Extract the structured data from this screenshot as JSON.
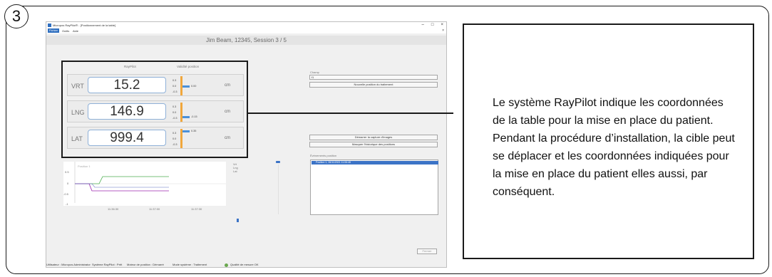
{
  "step": {
    "number": "3"
  },
  "app": {
    "title": "Micropos RayPilot® - [Positionnement de la table]",
    "window_buttons": [
      "–",
      "□",
      "×"
    ],
    "menu": [
      "Fichier",
      "Outils",
      "Aide"
    ],
    "patient_header": "Jim Beam, 12345, Session 3 / 5",
    "champ": {
      "label": "Champ",
      "value": "f1",
      "new_position_button": "Nouvelle position du traitement"
    },
    "capture_button": "Démarrer la capture d'images",
    "history_button": "Masquer l'historique des positions",
    "events": {
      "label": "Événements position",
      "rows": [
        "Position 1, 26/11/2021 11:06:48"
      ]
    },
    "graph": {
      "legend": [
        "Vrt",
        "Lng",
        "Lat"
      ],
      "x_ticks": [
        "11:36:30",
        "11:37:00",
        "11:37:30"
      ],
      "y_ticks": [
        "0.5",
        "0",
        "-0.5",
        "-1"
      ],
      "corner_label": "Position 1"
    },
    "bottom_button": "Fermer",
    "status": {
      "user": "Utilisateur : Micropos Administrator",
      "system": "Système RayPilot : Prêt",
      "motor": "Moteur de position : Démarré",
      "mode": "Mode système : Traitement",
      "quality": "Qualité de mesure OK"
    }
  },
  "zoom": {
    "headers": {
      "raypilot": "RayPilot",
      "validity": "Validité position"
    },
    "rows": [
      {
        "axis": "VRT",
        "value": "15.2",
        "unit": "cm",
        "ticks": [
          "0.3",
          "0.0",
          "-0.3"
        ],
        "tolerance_value": "0.00",
        "tolerance_level": 0.5
      },
      {
        "axis": "LNG",
        "value": "146.9",
        "unit": "cm",
        "ticks": [
          "0.3",
          "0.0",
          "-0.3"
        ],
        "tolerance_value": "-0.15",
        "tolerance_level": 0.75
      },
      {
        "axis": "LAT",
        "value": "999.4",
        "unit": "cm",
        "ticks": [
          "0.3",
          "0.0",
          "-0.3"
        ],
        "tolerance_value": "0.35",
        "tolerance_level": 0.1
      }
    ]
  },
  "info_text": "Le système RayPilot indique les coordonnées de la table pour la mise en place du patient. Pendant la procédure d’installation, la cible peut se déplacer et les coordonnées indiquées pour la mise en place du patient elles aussi, par conséquent.",
  "colors": {
    "accent": "#2f6fbf",
    "scale": "#f1a73c",
    "tolerance": "#4a90d9",
    "vrt_line": "#4caf50",
    "lng_line": "#9c27b0",
    "lat_line": "#5c6bc0"
  }
}
